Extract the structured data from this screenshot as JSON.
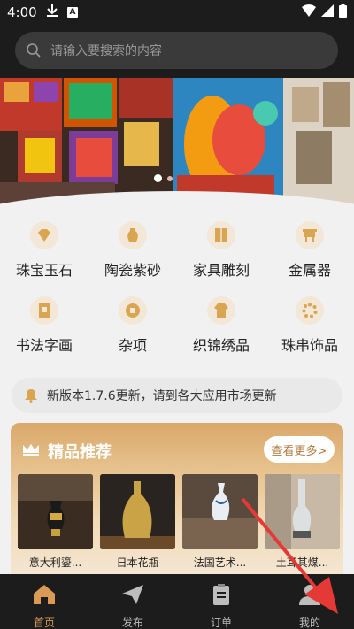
{
  "status": {
    "time": "4:00"
  },
  "search": {
    "placeholder": "请输入要搜索的内容"
  },
  "banner": {
    "dots_count": 2,
    "active_index": 0
  },
  "categories": [
    {
      "label": "珠宝玉石",
      "icon": "gem-icon"
    },
    {
      "label": "陶瓷紫砂",
      "icon": "vase-icon"
    },
    {
      "label": "家具雕刻",
      "icon": "cabinet-icon"
    },
    {
      "label": "金属器",
      "icon": "bronze-vessel-icon"
    },
    {
      "label": "书法字画",
      "icon": "scroll-icon"
    },
    {
      "label": "杂项",
      "icon": "coin-icon"
    },
    {
      "label": "织锦绣品",
      "icon": "robe-icon"
    },
    {
      "label": "珠串饰品",
      "icon": "beads-icon"
    }
  ],
  "notice": {
    "text": "新版本1.7.6更新，请到各大应用市场更新"
  },
  "recommend": {
    "title": "精品推荐",
    "more_label": "查看更多>",
    "items": [
      {
        "name": "意大利鎏..."
      },
      {
        "name": "日本花瓶"
      },
      {
        "name": "法国艺术..."
      },
      {
        "name": "土耳其煤..."
      }
    ]
  },
  "nav": {
    "tabs": [
      {
        "label": "首页",
        "active": true
      },
      {
        "label": "发布",
        "active": false
      },
      {
        "label": "订单",
        "active": false
      },
      {
        "label": "我的",
        "active": false
      }
    ]
  },
  "colors": {
    "accent": "#d89a54",
    "dark": "#1c1c1c",
    "arrow": "#e53935"
  }
}
